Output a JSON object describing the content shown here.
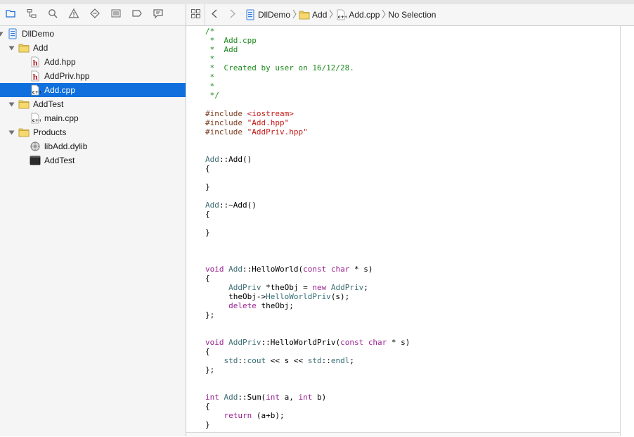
{
  "navigator": {
    "toolbar_icons": [
      "folder-icon",
      "hierarchy-icon",
      "search-icon",
      "warning-icon",
      "diamond-icon",
      "list-icon",
      "tag-icon",
      "message-icon"
    ],
    "tree": [
      {
        "label": "DllDemo",
        "icon": "project-icon",
        "level": 0,
        "disclosure": "open"
      },
      {
        "label": "Add",
        "icon": "folder-icon",
        "level": 1,
        "disclosure": "open"
      },
      {
        "label": "Add.hpp",
        "icon": "header-file-icon",
        "level": 2
      },
      {
        "label": "AddPriv.hpp",
        "icon": "header-file-icon",
        "level": 2
      },
      {
        "label": "Add.cpp",
        "icon": "cpp-file-icon",
        "level": 2,
        "selected": true
      },
      {
        "label": "AddTest",
        "icon": "folder-icon",
        "level": 1,
        "disclosure": "open"
      },
      {
        "label": "main.cpp",
        "icon": "cpp-file-icon",
        "level": 2
      },
      {
        "label": "Products",
        "icon": "folder-icon",
        "level": 1,
        "disclosure": "open"
      },
      {
        "label": "libAdd.dylib",
        "icon": "library-icon",
        "level": 2
      },
      {
        "label": "AddTest",
        "icon": "terminal-icon",
        "level": 2
      }
    ]
  },
  "jumpbar": {
    "crumbs": [
      {
        "label": "DllDemo",
        "icon": "project-icon"
      },
      {
        "label": "Add",
        "icon": "folder-icon"
      },
      {
        "label": "Add.cpp",
        "icon": "cpp-file-icon"
      },
      {
        "label": "No Selection",
        "icon": ""
      }
    ]
  },
  "editor": {
    "lines": [
      [
        {
          "t": "/*",
          "c": "comment"
        }
      ],
      [
        {
          "t": " *  Add.cpp",
          "c": "comment"
        }
      ],
      [
        {
          "t": " *  Add",
          "c": "comment"
        }
      ],
      [
        {
          "t": " *",
          "c": "comment"
        }
      ],
      [
        {
          "t": " *  Created by user on 16/12/28.",
          "c": "comment"
        }
      ],
      [
        {
          "t": " *",
          "c": "comment"
        }
      ],
      [
        {
          "t": " *",
          "c": "comment"
        }
      ],
      [
        {
          "t": " */",
          "c": "comment"
        }
      ],
      [],
      [
        {
          "t": "#include ",
          "c": "pre"
        },
        {
          "t": "<iostream>",
          "c": "str"
        }
      ],
      [
        {
          "t": "#include ",
          "c": "pre"
        },
        {
          "t": "\"Add.hpp\"",
          "c": "str"
        }
      ],
      [
        {
          "t": "#include ",
          "c": "pre"
        },
        {
          "t": "\"AddPriv.hpp\"",
          "c": "str"
        }
      ],
      [],
      [],
      [
        {
          "t": "Add",
          "c": "type"
        },
        {
          "t": "::Add()",
          "c": "plain"
        }
      ],
      [
        {
          "t": "{",
          "c": "plain"
        }
      ],
      [],
      [
        {
          "t": "}",
          "c": "plain"
        }
      ],
      [],
      [
        {
          "t": "Add",
          "c": "type"
        },
        {
          "t": "::~Add()",
          "c": "plain"
        }
      ],
      [
        {
          "t": "{",
          "c": "plain"
        }
      ],
      [],
      [
        {
          "t": "}",
          "c": "plain"
        }
      ],
      [],
      [],
      [],
      [
        {
          "t": "void ",
          "c": "kw"
        },
        {
          "t": "Add",
          "c": "type"
        },
        {
          "t": "::HelloWorld(",
          "c": "plain"
        },
        {
          "t": "const char",
          "c": "kw"
        },
        {
          "t": " * s)",
          "c": "plain"
        }
      ],
      [
        {
          "t": "{",
          "c": "plain"
        }
      ],
      [
        {
          "t": "     ",
          "c": "plain"
        },
        {
          "t": "AddPriv",
          "c": "type"
        },
        {
          "t": " *theObj = ",
          "c": "plain"
        },
        {
          "t": "new ",
          "c": "kw"
        },
        {
          "t": "AddPriv",
          "c": "type"
        },
        {
          "t": ";",
          "c": "plain"
        }
      ],
      [
        {
          "t": "     theObj->",
          "c": "plain"
        },
        {
          "t": "HelloWorldPriv",
          "c": "fn"
        },
        {
          "t": "(s);",
          "c": "plain"
        }
      ],
      [
        {
          "t": "     ",
          "c": "plain"
        },
        {
          "t": "delete",
          "c": "kw"
        },
        {
          "t": " theObj;",
          "c": "plain"
        }
      ],
      [
        {
          "t": "};",
          "c": "plain"
        }
      ],
      [],
      [],
      [
        {
          "t": "void ",
          "c": "kw"
        },
        {
          "t": "AddPriv",
          "c": "type"
        },
        {
          "t": "::HelloWorldPriv(",
          "c": "plain"
        },
        {
          "t": "const char",
          "c": "kw"
        },
        {
          "t": " * s)",
          "c": "plain"
        }
      ],
      [
        {
          "t": "{",
          "c": "plain"
        }
      ],
      [
        {
          "t": "    ",
          "c": "plain"
        },
        {
          "t": "std",
          "c": "type"
        },
        {
          "t": "::",
          "c": "plain"
        },
        {
          "t": "cout",
          "c": "fn"
        },
        {
          "t": " << s << ",
          "c": "plain"
        },
        {
          "t": "std",
          "c": "type"
        },
        {
          "t": "::",
          "c": "plain"
        },
        {
          "t": "endl",
          "c": "fn"
        },
        {
          "t": ";",
          "c": "plain"
        }
      ],
      [
        {
          "t": "};",
          "c": "plain"
        }
      ],
      [],
      [],
      [
        {
          "t": "int ",
          "c": "kw"
        },
        {
          "t": "Add",
          "c": "type"
        },
        {
          "t": "::Sum(",
          "c": "plain"
        },
        {
          "t": "int",
          "c": "kw"
        },
        {
          "t": " a, ",
          "c": "plain"
        },
        {
          "t": "int",
          "c": "kw"
        },
        {
          "t": " b)",
          "c": "plain"
        }
      ],
      [
        {
          "t": "{",
          "c": "plain"
        }
      ],
      [
        {
          "t": "    ",
          "c": "plain"
        },
        {
          "t": "return",
          "c": "kw"
        },
        {
          "t": " (a+b);",
          "c": "plain"
        }
      ],
      [
        {
          "t": "}",
          "c": "plain"
        }
      ]
    ]
  },
  "colors": {
    "selection": "#0f6fdc",
    "comment": "#1d8a1d",
    "string": "#c41a16",
    "keyword": "#9b2393",
    "type": "#3f6e74"
  }
}
